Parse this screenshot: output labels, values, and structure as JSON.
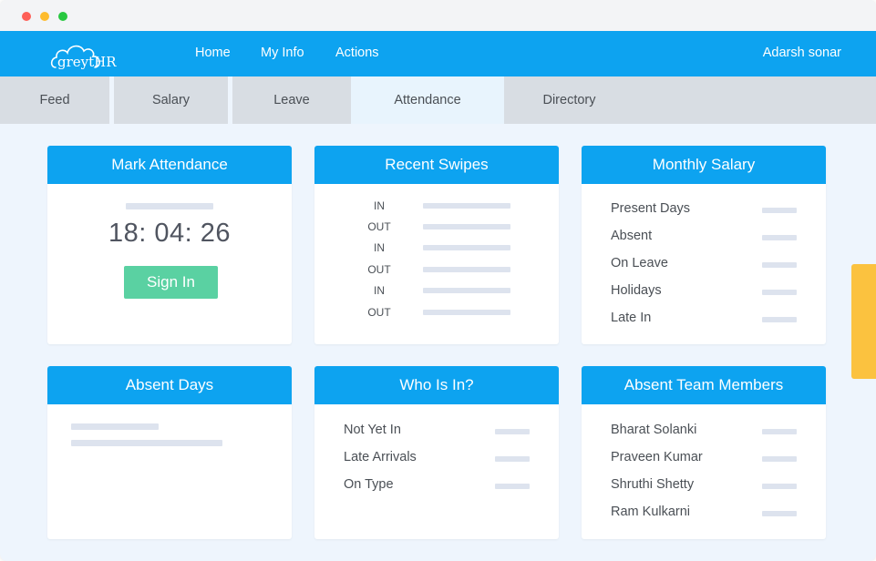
{
  "colors": {
    "brand": "#0da3f0",
    "sign_in": "#5ad1a2",
    "handle": "#fbc23f"
  },
  "logo": {
    "text": "greytHR",
    "icon": "cloud-icon"
  },
  "nav": {
    "home": "Home",
    "my_info": "My Info",
    "actions": "Actions",
    "user": "Adarsh sonar"
  },
  "tabs": [
    "Feed",
    "Salary",
    "Leave",
    "Attendance",
    "Directory"
  ],
  "active_tab": "Attendance",
  "mark_attendance": {
    "title": "Mark Attendance",
    "clock": "18: 04: 26",
    "sign_in_label": "Sign In"
  },
  "recent_swipes": {
    "title": "Recent Swipes",
    "entries": [
      "IN",
      "OUT",
      "IN",
      "OUT",
      "IN",
      "OUT"
    ]
  },
  "monthly_salary": {
    "title": "Monthly Salary",
    "rows": [
      "Present Days",
      "Absent",
      "On Leave",
      "Holidays",
      "Late In"
    ]
  },
  "absent_days": {
    "title": "Absent Days"
  },
  "who_is_in": {
    "title": "Who Is In?",
    "rows": [
      "Not Yet In",
      "Late Arrivals",
      "On Type"
    ]
  },
  "absent_team": {
    "title": "Absent Team Members",
    "rows": [
      "Bharat Solanki",
      "Praveen Kumar",
      "Shruthi Shetty",
      "Ram Kulkarni"
    ]
  }
}
